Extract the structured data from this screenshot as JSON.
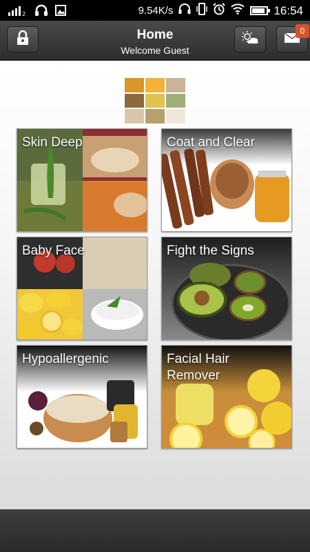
{
  "status_bar": {
    "network_speed": "9.54K/s",
    "time": "16:54",
    "battery_level": 0.9,
    "icons": [
      "signal-icon",
      "headphones-icon",
      "image-icon",
      "headset-icon",
      "vibrate-icon",
      "alarm-icon",
      "wifi-icon",
      "battery-icon"
    ]
  },
  "header": {
    "title": "Home",
    "subtitle": "Welcome Guest",
    "lock_icon": "lock-icon",
    "weather_icon": "weather-icon",
    "mail_icon": "mail-icon",
    "mail_badge": "0",
    "background": "#3a3a3a",
    "badge_color": "#d7542b"
  },
  "tiles": [
    {
      "label": "Skin Deep"
    },
    {
      "label": "Coat and Clear"
    },
    {
      "label": "Baby Face"
    },
    {
      "label": "Fight the Signs"
    },
    {
      "label": "Hypoallergenic"
    },
    {
      "label": "Facial Hair Remover"
    }
  ]
}
